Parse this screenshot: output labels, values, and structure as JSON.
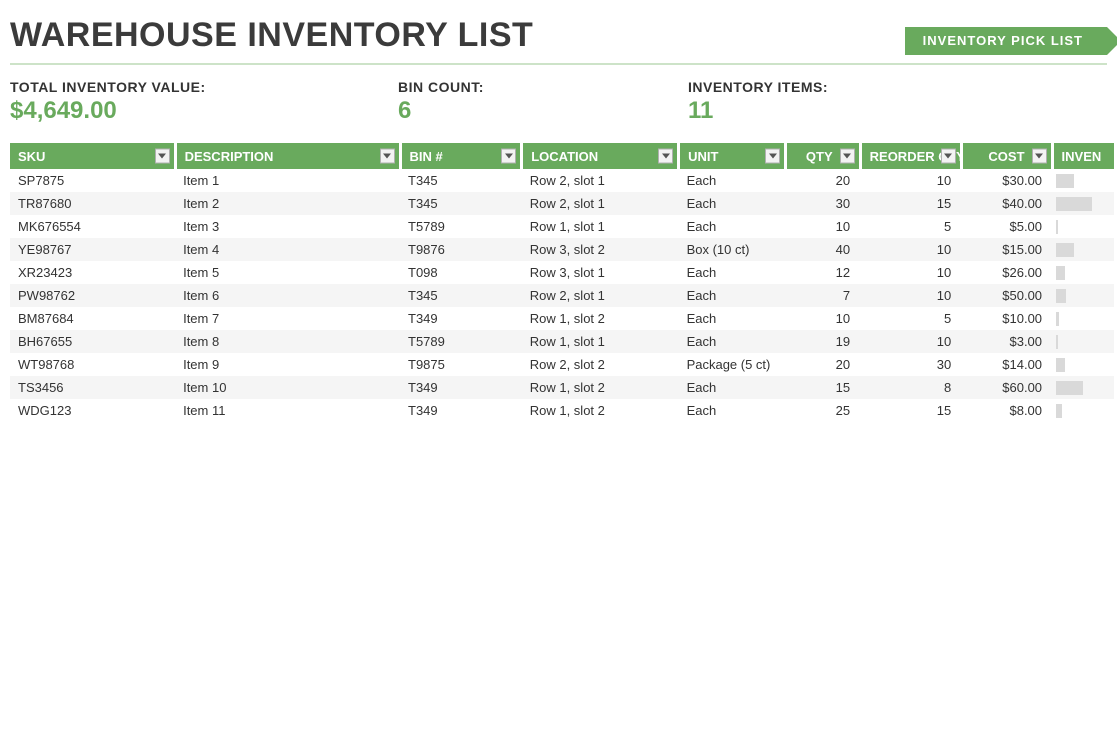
{
  "title": "WAREHOUSE INVENTORY LIST",
  "pickListButton": "INVENTORY  PICK LIST",
  "summary": {
    "totalLabel": "TOTAL INVENTORY VALUE:",
    "totalValue": "$4,649.00",
    "binLabel": "BIN COUNT:",
    "binValue": "6",
    "itemsLabel": "INVENTORY ITEMS:",
    "itemsValue": "11"
  },
  "columns": {
    "sku": "SKU",
    "desc": "DESCRIPTION",
    "bin": "BIN #",
    "loc": "LOCATION",
    "unit": "UNIT",
    "qty": "QTY",
    "rqty": "REORDER QTY",
    "cost": "COST",
    "inv": "INVEN"
  },
  "rows": [
    {
      "sku": "SP7875",
      "desc": "Item 1",
      "bin": "T345",
      "loc": "Row 2, slot 1",
      "unit": "Each",
      "qty": "20",
      "rqty": "10",
      "cost": "$30.00",
      "barPct": 33
    },
    {
      "sku": "TR87680",
      "desc": "Item 2",
      "bin": "T345",
      "loc": "Row 2, slot 1",
      "unit": "Each",
      "qty": "30",
      "rqty": "15",
      "cost": "$40.00",
      "barPct": 67
    },
    {
      "sku": "MK676554",
      "desc": "Item 3",
      "bin": "T5789",
      "loc": "Row 1, slot 1",
      "unit": "Each",
      "qty": "10",
      "rqty": "5",
      "cost": "$5.00",
      "barPct": 3
    },
    {
      "sku": "YE98767",
      "desc": "Item 4",
      "bin": "T9876",
      "loc": "Row 3, slot 2",
      "unit": "Box (10 ct)",
      "qty": "40",
      "rqty": "10",
      "cost": "$15.00",
      "barPct": 33
    },
    {
      "sku": "XR23423",
      "desc": "Item 5",
      "bin": "T098",
      "loc": "Row 3, slot 1",
      "unit": "Each",
      "qty": "12",
      "rqty": "10",
      "cost": "$26.00",
      "barPct": 17
    },
    {
      "sku": "PW98762",
      "desc": "Item 6",
      "bin": "T345",
      "loc": "Row 2, slot 1",
      "unit": "Each",
      "qty": "7",
      "rqty": "10",
      "cost": "$50.00",
      "barPct": 19
    },
    {
      "sku": "BM87684",
      "desc": "Item 7",
      "bin": "T349",
      "loc": "Row 1, slot 2",
      "unit": "Each",
      "qty": "10",
      "rqty": "5",
      "cost": "$10.00",
      "barPct": 6
    },
    {
      "sku": "BH67655",
      "desc": "Item 8",
      "bin": "T5789",
      "loc": "Row 1, slot 1",
      "unit": "Each",
      "qty": "19",
      "rqty": "10",
      "cost": "$3.00",
      "barPct": 3
    },
    {
      "sku": "WT98768",
      "desc": "Item 9",
      "bin": "T9875",
      "loc": "Row 2, slot 2",
      "unit": "Package (5 ct)",
      "qty": "20",
      "rqty": "30",
      "cost": "$14.00",
      "barPct": 16
    },
    {
      "sku": "TS3456",
      "desc": "Item 10",
      "bin": "T349",
      "loc": "Row 1, slot 2",
      "unit": "Each",
      "qty": "15",
      "rqty": "8",
      "cost": "$60.00",
      "barPct": 50
    },
    {
      "sku": "WDG123",
      "desc": "Item 11",
      "bin": "T349",
      "loc": "Row 1, slot 2",
      "unit": "Each",
      "qty": "25",
      "rqty": "15",
      "cost": "$8.00",
      "barPct": 11
    }
  ]
}
